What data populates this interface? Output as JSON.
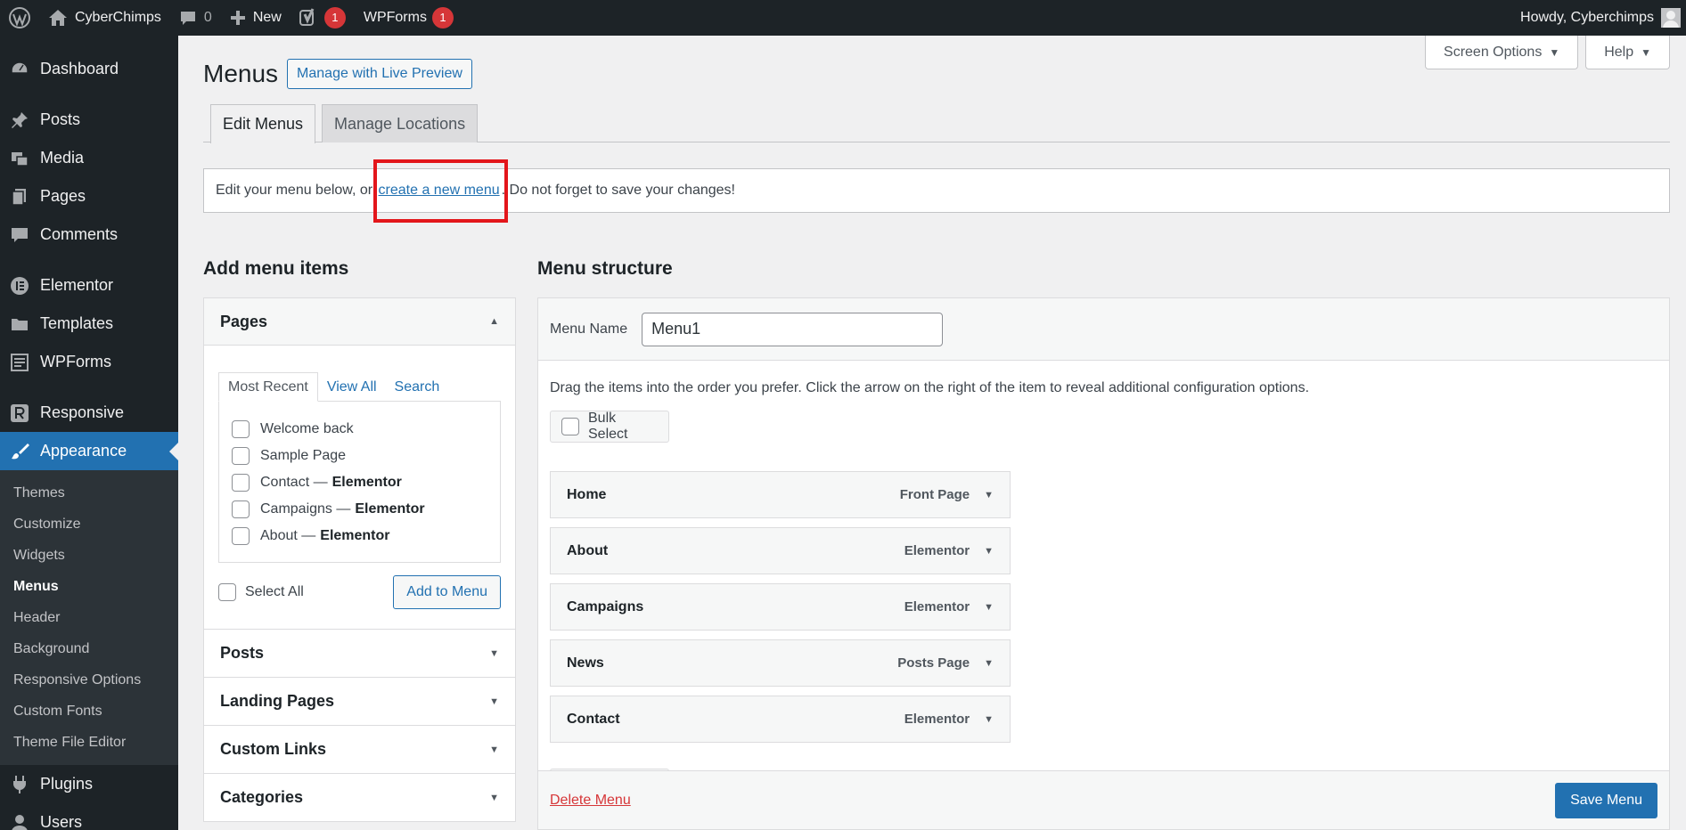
{
  "adminbar": {
    "site_name": "CyberChimps",
    "comments_count": "0",
    "new_label": "New",
    "yoast_badge": "1",
    "wpforms_label": "WPForms",
    "wpforms_badge": "1",
    "howdy": "Howdy, Cyberchimps"
  },
  "sidebar": {
    "dashboard": "Dashboard",
    "posts": "Posts",
    "media": "Media",
    "pages": "Pages",
    "comments": "Comments",
    "elementor": "Elementor",
    "templates": "Templates",
    "wpforms": "WPForms",
    "responsive": "Responsive",
    "appearance": "Appearance",
    "submenu": [
      "Themes",
      "Customize",
      "Widgets",
      "Menus",
      "Header",
      "Background",
      "Responsive Options",
      "Custom Fonts",
      "Theme File Editor"
    ],
    "plugins": "Plugins",
    "users": "Users"
  },
  "screen_meta": {
    "screen_options": "Screen Options",
    "help": "Help"
  },
  "page": {
    "title": "Menus",
    "live_preview": "Manage with Live Preview",
    "tab_edit": "Edit Menus",
    "tab_locations": "Manage Locations",
    "notice_before": "Edit your menu below, or",
    "notice_link": "create a new menu",
    "notice_after": ". Do not forget to save your changes!"
  },
  "add_items": {
    "title": "Add menu items",
    "pages_head": "Pages",
    "tabs": [
      "Most Recent",
      "View All",
      "Search"
    ],
    "pages": [
      {
        "name": "Welcome back",
        "suffix": ""
      },
      {
        "name": "Sample Page",
        "suffix": ""
      },
      {
        "name": "Contact —",
        "suffix": "Elementor"
      },
      {
        "name": "Campaigns —",
        "suffix": "Elementor"
      },
      {
        "name": "About —",
        "suffix": "Elementor"
      }
    ],
    "select_all": "Select All",
    "add_to_menu": "Add to Menu",
    "other_sections": [
      "Posts",
      "Landing Pages",
      "Custom Links",
      "Categories"
    ]
  },
  "menu_structure": {
    "title": "Menu structure",
    "name_label": "Menu Name",
    "name_value": "Menu1",
    "instructions": "Drag the items into the order you prefer. Click the arrow on the right of the item to reveal additional configuration options.",
    "bulk_select": "Bulk Select",
    "items": [
      {
        "title": "Home",
        "type": "Front Page"
      },
      {
        "title": "About",
        "type": "Elementor"
      },
      {
        "title": "Campaigns",
        "type": "Elementor"
      },
      {
        "title": "News",
        "type": "Posts Page"
      },
      {
        "title": "Contact",
        "type": "Elementor"
      }
    ],
    "delete_menu": "Delete Menu",
    "save_menu": "Save Menu"
  },
  "colors": {
    "admin_dark": "#1d2327",
    "accent": "#2271b1",
    "highlight": "#e3161b",
    "danger": "#d63638"
  }
}
